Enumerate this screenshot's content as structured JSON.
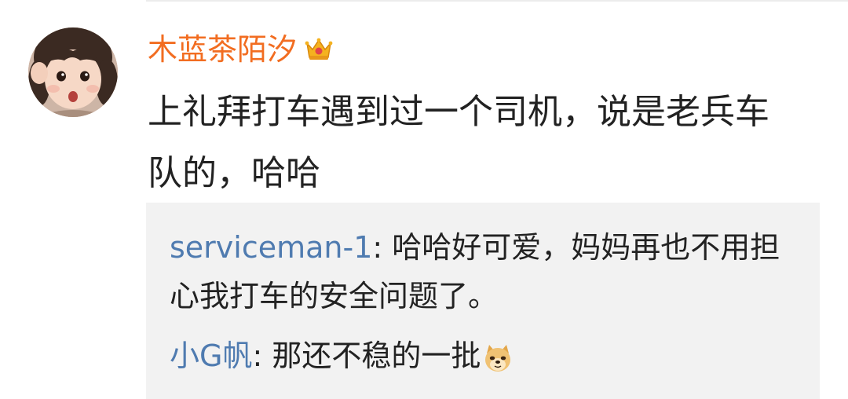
{
  "comment": {
    "username": "木蓝茶陌汐",
    "username_color": "#f26d21",
    "badge_icon": "crown-icon",
    "text": "上礼拜打车遇到过一个司机，说是老兵车队的，哈哈"
  },
  "replies": [
    {
      "author": "serviceman-1",
      "separator": ": ",
      "text": "哈哈好可爱，妈妈再也不用担心我打车的安全问题了。"
    },
    {
      "author": "小G帆",
      "separator": ": ",
      "text": "那还不稳的一批",
      "emoji": "doge-icon"
    }
  ],
  "colors": {
    "author_link": "#4f7bb0",
    "reply_background": "#f2f2f2",
    "text": "#222222"
  }
}
